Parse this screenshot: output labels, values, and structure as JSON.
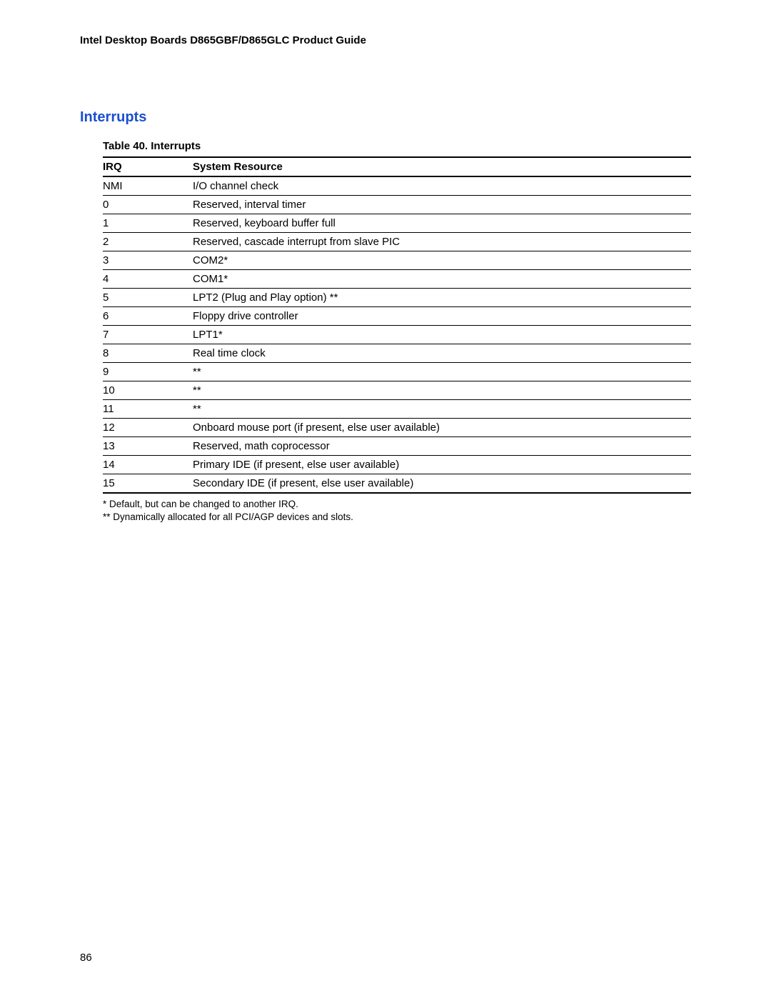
{
  "header": {
    "running_title": "Intel Desktop Boards D865GBF/D865GLC Product Guide"
  },
  "section": {
    "heading": "Interrupts"
  },
  "table": {
    "caption": "Table 40.    Interrupts",
    "columns": {
      "irq": "IRQ",
      "resource": "System Resource"
    },
    "rows": [
      {
        "irq": "NMI",
        "resource": "I/O channel check"
      },
      {
        "irq": "0",
        "resource": "Reserved, interval timer"
      },
      {
        "irq": "1",
        "resource": "Reserved, keyboard buffer full"
      },
      {
        "irq": "2",
        "resource": "Reserved, cascade interrupt from slave PIC"
      },
      {
        "irq": "3",
        "resource": "COM2*"
      },
      {
        "irq": "4",
        "resource": "COM1*"
      },
      {
        "irq": "5",
        "resource": "LPT2 (Plug and Play option) **"
      },
      {
        "irq": "6",
        "resource": "Floppy drive controller"
      },
      {
        "irq": "7",
        "resource": "LPT1*"
      },
      {
        "irq": "8",
        "resource": "Real time clock"
      },
      {
        "irq": "9",
        "resource": "**"
      },
      {
        "irq": "10",
        "resource": "**"
      },
      {
        "irq": "11",
        "resource": "**"
      },
      {
        "irq": "12",
        "resource": "Onboard mouse port (if present, else user available)"
      },
      {
        "irq": "13",
        "resource": "Reserved, math coprocessor"
      },
      {
        "irq": "14",
        "resource": "Primary IDE (if present, else user available)"
      },
      {
        "irq": "15",
        "resource": "Secondary IDE (if present, else user available)"
      }
    ]
  },
  "footnotes": {
    "note1": "*  Default, but can be changed to another IRQ.",
    "note2": "** Dynamically allocated for all PCI/AGP devices and slots."
  },
  "page_number": "86"
}
